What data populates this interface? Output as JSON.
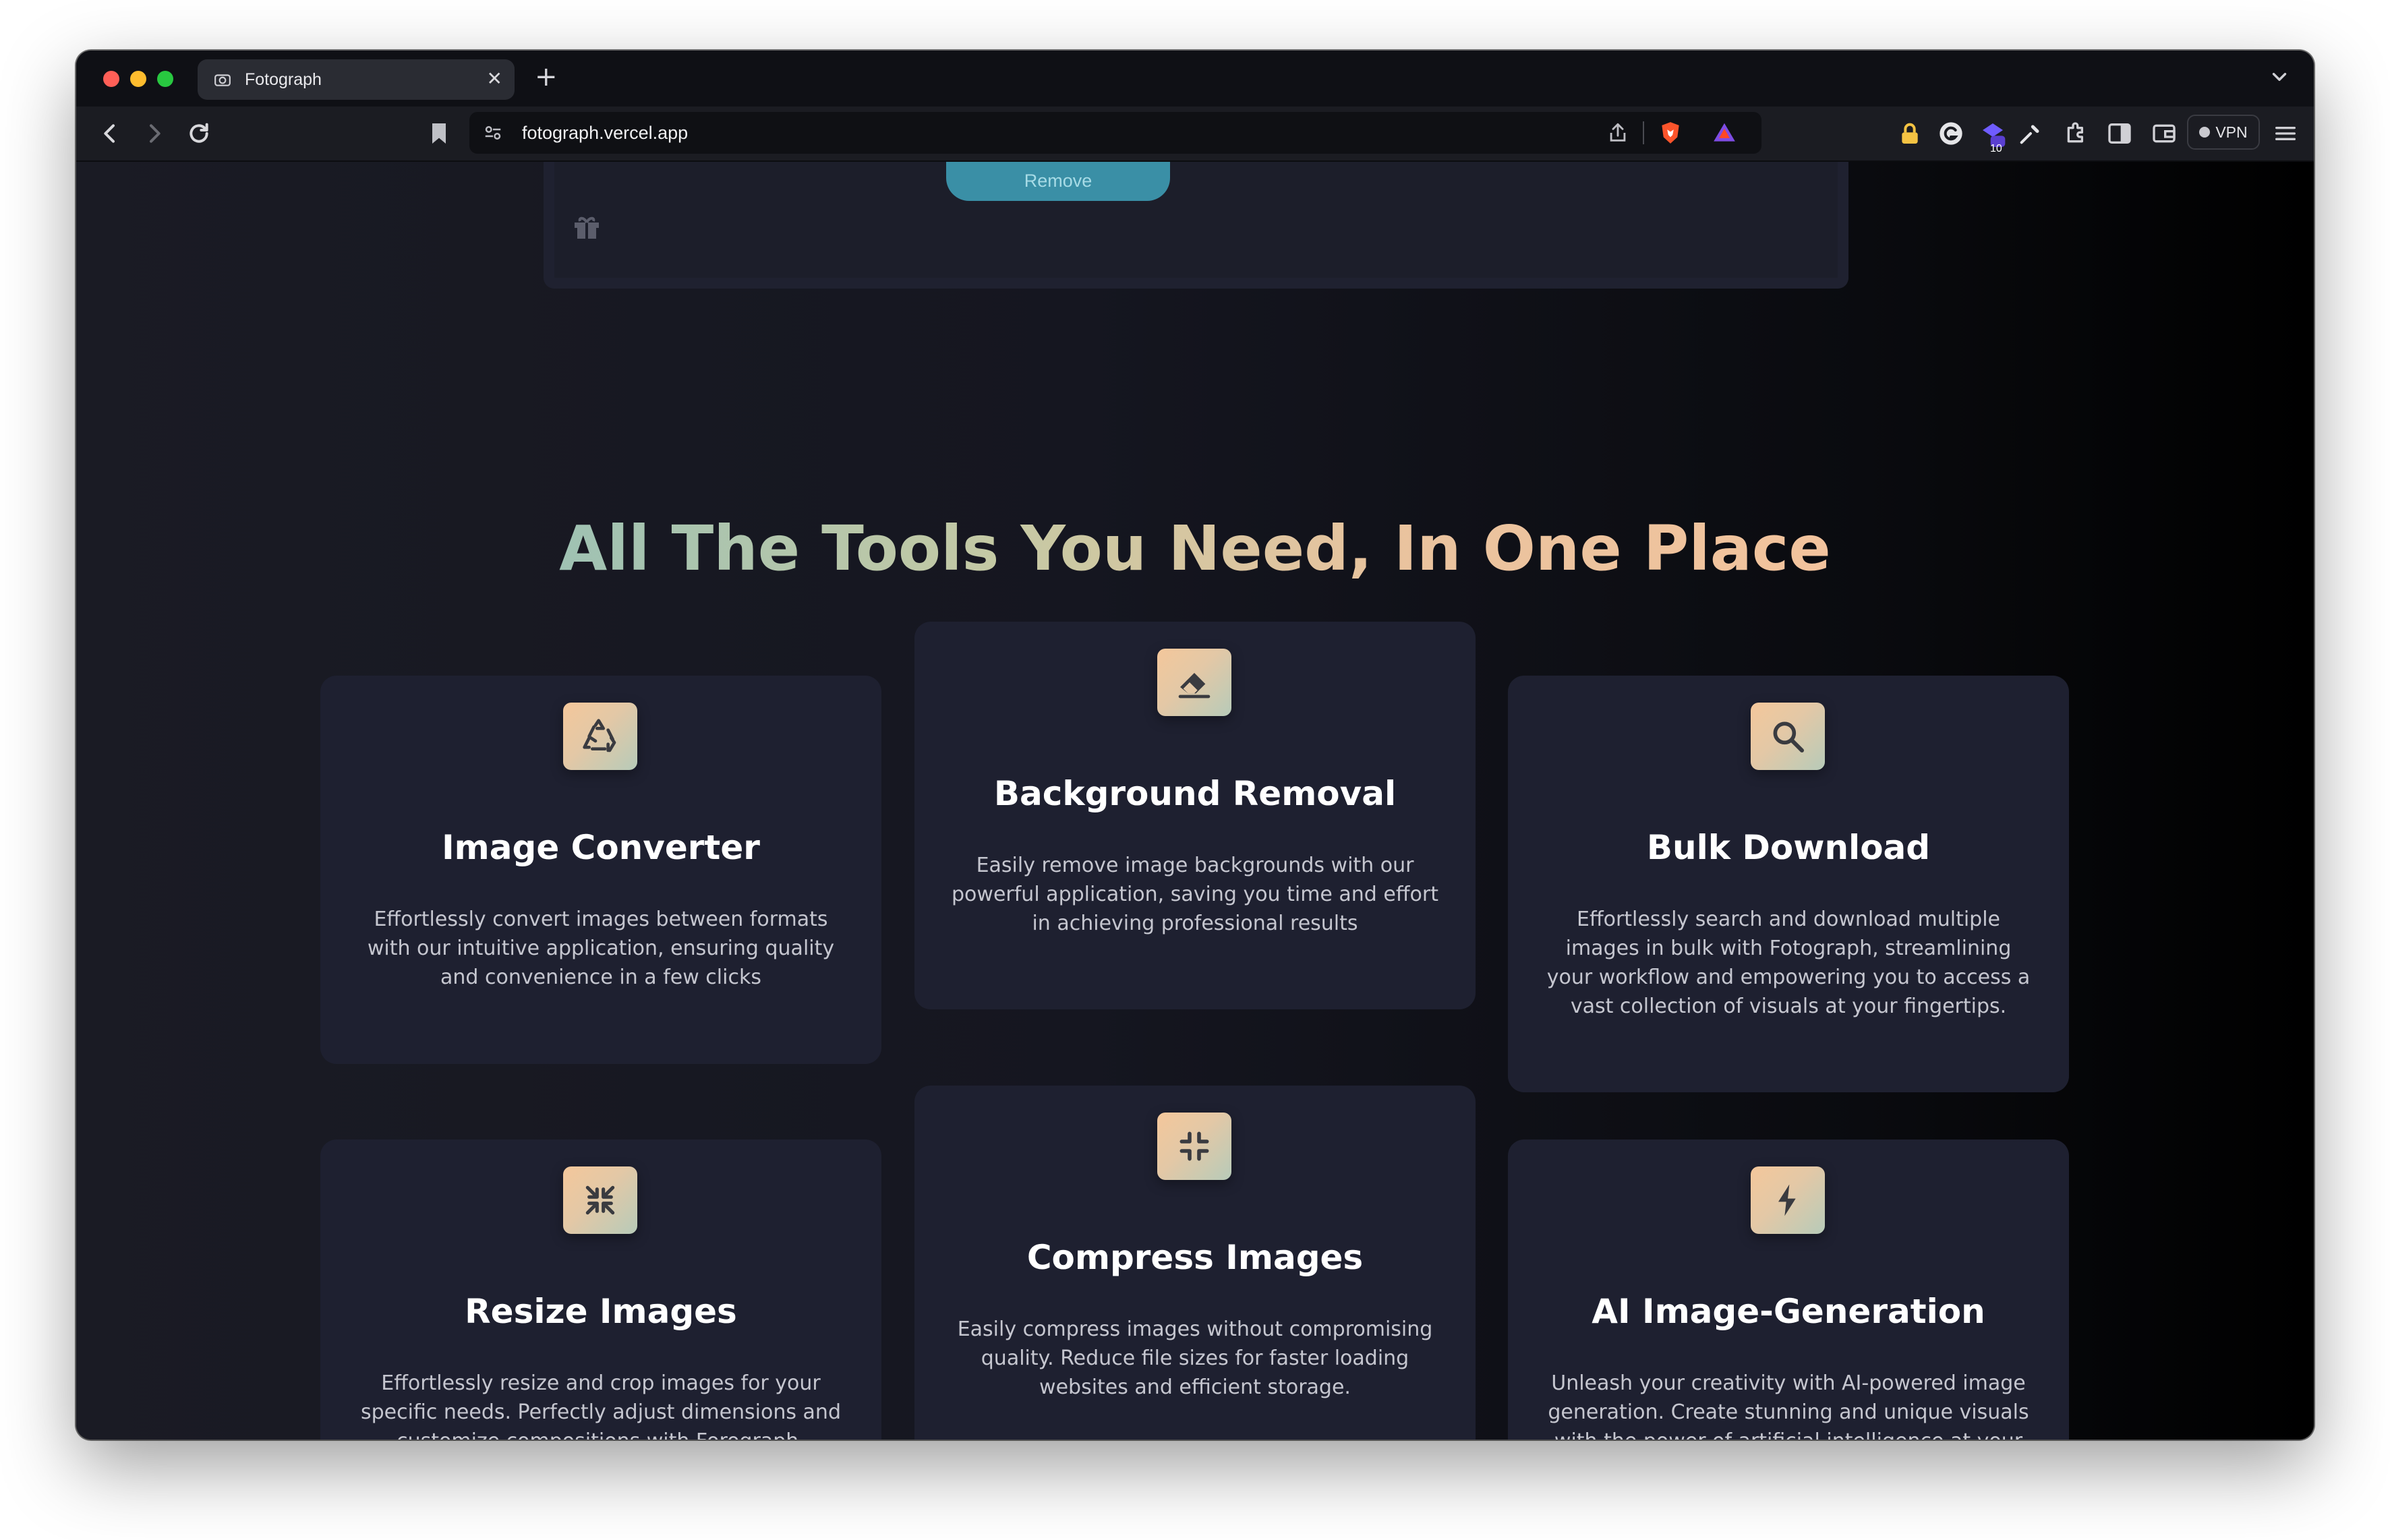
{
  "browser": {
    "tab_title": "Fotograph",
    "tab_close": "✕",
    "new_tab": "+",
    "url": "fotograph.vercel.app",
    "vpn_label": "VPN",
    "extension_badge": "10"
  },
  "page": {
    "remove_button": "Remove",
    "heading": "All The Tools You Need, In One Place",
    "features": [
      {
        "icon": "recycle-icon",
        "title": "Image Converter",
        "description": "Effortlessly convert images between formats with our intuitive application, ensuring quality and convenience in a few clicks"
      },
      {
        "icon": "eraser-icon",
        "title": "Background Removal",
        "description": "Easily remove image backgrounds with our powerful application, saving you time and effort in achieving professional results"
      },
      {
        "icon": "search-icon",
        "title": "Bulk Download",
        "description": "Effortlessly search and download multiple images in bulk with Fotograph, streamlining your workflow and empowering you to access a vast collection of visuals at your fingertips."
      },
      {
        "icon": "resize-icon",
        "title": "Resize Images",
        "description": "Effortlessly resize and crop images for your specific needs. Perfectly adjust dimensions and customize compositions with Forograph."
      },
      {
        "icon": "compress-icon",
        "title": "Compress Images",
        "description": "Easily compress images without compromising quality. Reduce file sizes for faster loading websites and efficient storage."
      },
      {
        "icon": "lightning-icon",
        "title": "AI Image-Generation",
        "description": "Unleash your creativity with AI-powered image generation. Create stunning and unique visuals with the power of artificial intelligence at your fingertips"
      }
    ]
  },
  "colors": {
    "page_background": "#151620",
    "card_background": "#1e2030",
    "heading_gradient_start": "#9fc2b3",
    "heading_gradient_end": "#f2c39d",
    "remove_button": "#3a8fa6"
  }
}
